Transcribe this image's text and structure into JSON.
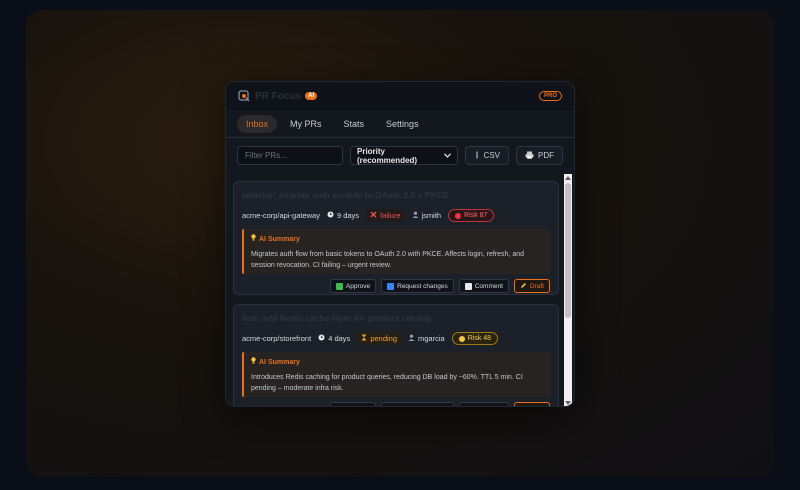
{
  "header": {
    "brand": "PR Focus",
    "ai_badge": "AI",
    "pro_badge": "PRO"
  },
  "tabs": [
    {
      "label": "Inbox",
      "active": true
    },
    {
      "label": "My PRs",
      "active": false
    },
    {
      "label": "Stats",
      "active": false
    },
    {
      "label": "Settings",
      "active": false
    }
  ],
  "toolbar": {
    "filter_placeholder": "Filter PRs...",
    "sort_value": "Priority (recommended)",
    "csv_label": "CSV",
    "pdf_label": "PDF"
  },
  "prs": [
    {
      "title": "refactor: migrate auth module to OAuth 2.0 + PKCE",
      "repo": "acme-corp/api-gateway",
      "age": "9 days",
      "status": "failure",
      "author": "jsmith",
      "risk": "Risk 87",
      "summary_head": "AI Summary",
      "summary": "Migrates auth flow from basic tokens to OAuth 2.0 with PKCE. Affects login, refresh, and session revocation. CI failing – urgent review."
    },
    {
      "title": "feat: add Redis cache layer for product catalog",
      "repo": "acme-corp/storefront",
      "age": "4 days",
      "status": "pending",
      "author": "mgarcia",
      "risk": "Risk 48",
      "summary_head": "AI Summary",
      "summary": "Introduces Redis caching for product queries, reducing DB load by ~60%. TTL 5 min. CI pending – moderate infra risk."
    }
  ],
  "actions": {
    "approve": "Approve",
    "request": "Request changes",
    "comment": "Comment",
    "draft": "Draft"
  },
  "colors": {
    "accent": "#e9701e",
    "failure": "#ef5350",
    "pending": "#f0a030"
  }
}
